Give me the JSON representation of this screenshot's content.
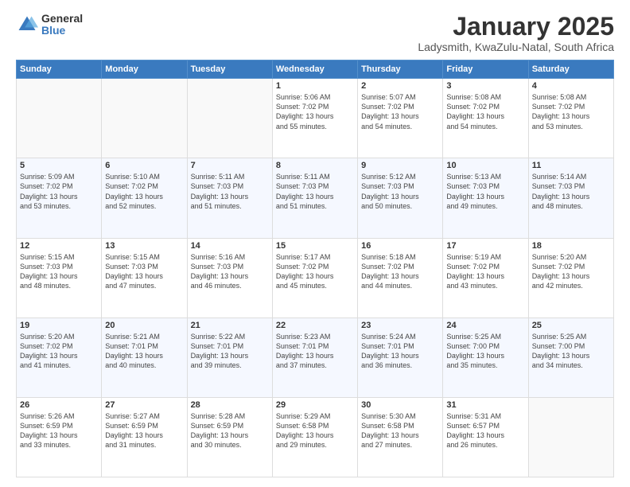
{
  "header": {
    "logo_general": "General",
    "logo_blue": "Blue",
    "month_title": "January 2025",
    "location": "Ladysmith, KwaZulu-Natal, South Africa"
  },
  "days_of_week": [
    "Sunday",
    "Monday",
    "Tuesday",
    "Wednesday",
    "Thursday",
    "Friday",
    "Saturday"
  ],
  "weeks": [
    [
      {
        "day": "",
        "info": ""
      },
      {
        "day": "",
        "info": ""
      },
      {
        "day": "",
        "info": ""
      },
      {
        "day": "1",
        "info": "Sunrise: 5:06 AM\nSunset: 7:02 PM\nDaylight: 13 hours\nand 55 minutes."
      },
      {
        "day": "2",
        "info": "Sunrise: 5:07 AM\nSunset: 7:02 PM\nDaylight: 13 hours\nand 54 minutes."
      },
      {
        "day": "3",
        "info": "Sunrise: 5:08 AM\nSunset: 7:02 PM\nDaylight: 13 hours\nand 54 minutes."
      },
      {
        "day": "4",
        "info": "Sunrise: 5:08 AM\nSunset: 7:02 PM\nDaylight: 13 hours\nand 53 minutes."
      }
    ],
    [
      {
        "day": "5",
        "info": "Sunrise: 5:09 AM\nSunset: 7:02 PM\nDaylight: 13 hours\nand 53 minutes."
      },
      {
        "day": "6",
        "info": "Sunrise: 5:10 AM\nSunset: 7:02 PM\nDaylight: 13 hours\nand 52 minutes."
      },
      {
        "day": "7",
        "info": "Sunrise: 5:11 AM\nSunset: 7:03 PM\nDaylight: 13 hours\nand 51 minutes."
      },
      {
        "day": "8",
        "info": "Sunrise: 5:11 AM\nSunset: 7:03 PM\nDaylight: 13 hours\nand 51 minutes."
      },
      {
        "day": "9",
        "info": "Sunrise: 5:12 AM\nSunset: 7:03 PM\nDaylight: 13 hours\nand 50 minutes."
      },
      {
        "day": "10",
        "info": "Sunrise: 5:13 AM\nSunset: 7:03 PM\nDaylight: 13 hours\nand 49 minutes."
      },
      {
        "day": "11",
        "info": "Sunrise: 5:14 AM\nSunset: 7:03 PM\nDaylight: 13 hours\nand 48 minutes."
      }
    ],
    [
      {
        "day": "12",
        "info": "Sunrise: 5:15 AM\nSunset: 7:03 PM\nDaylight: 13 hours\nand 48 minutes."
      },
      {
        "day": "13",
        "info": "Sunrise: 5:15 AM\nSunset: 7:03 PM\nDaylight: 13 hours\nand 47 minutes."
      },
      {
        "day": "14",
        "info": "Sunrise: 5:16 AM\nSunset: 7:03 PM\nDaylight: 13 hours\nand 46 minutes."
      },
      {
        "day": "15",
        "info": "Sunrise: 5:17 AM\nSunset: 7:02 PM\nDaylight: 13 hours\nand 45 minutes."
      },
      {
        "day": "16",
        "info": "Sunrise: 5:18 AM\nSunset: 7:02 PM\nDaylight: 13 hours\nand 44 minutes."
      },
      {
        "day": "17",
        "info": "Sunrise: 5:19 AM\nSunset: 7:02 PM\nDaylight: 13 hours\nand 43 minutes."
      },
      {
        "day": "18",
        "info": "Sunrise: 5:20 AM\nSunset: 7:02 PM\nDaylight: 13 hours\nand 42 minutes."
      }
    ],
    [
      {
        "day": "19",
        "info": "Sunrise: 5:20 AM\nSunset: 7:02 PM\nDaylight: 13 hours\nand 41 minutes."
      },
      {
        "day": "20",
        "info": "Sunrise: 5:21 AM\nSunset: 7:01 PM\nDaylight: 13 hours\nand 40 minutes."
      },
      {
        "day": "21",
        "info": "Sunrise: 5:22 AM\nSunset: 7:01 PM\nDaylight: 13 hours\nand 39 minutes."
      },
      {
        "day": "22",
        "info": "Sunrise: 5:23 AM\nSunset: 7:01 PM\nDaylight: 13 hours\nand 37 minutes."
      },
      {
        "day": "23",
        "info": "Sunrise: 5:24 AM\nSunset: 7:01 PM\nDaylight: 13 hours\nand 36 minutes."
      },
      {
        "day": "24",
        "info": "Sunrise: 5:25 AM\nSunset: 7:00 PM\nDaylight: 13 hours\nand 35 minutes."
      },
      {
        "day": "25",
        "info": "Sunrise: 5:25 AM\nSunset: 7:00 PM\nDaylight: 13 hours\nand 34 minutes."
      }
    ],
    [
      {
        "day": "26",
        "info": "Sunrise: 5:26 AM\nSunset: 6:59 PM\nDaylight: 13 hours\nand 33 minutes."
      },
      {
        "day": "27",
        "info": "Sunrise: 5:27 AM\nSunset: 6:59 PM\nDaylight: 13 hours\nand 31 minutes."
      },
      {
        "day": "28",
        "info": "Sunrise: 5:28 AM\nSunset: 6:59 PM\nDaylight: 13 hours\nand 30 minutes."
      },
      {
        "day": "29",
        "info": "Sunrise: 5:29 AM\nSunset: 6:58 PM\nDaylight: 13 hours\nand 29 minutes."
      },
      {
        "day": "30",
        "info": "Sunrise: 5:30 AM\nSunset: 6:58 PM\nDaylight: 13 hours\nand 27 minutes."
      },
      {
        "day": "31",
        "info": "Sunrise: 5:31 AM\nSunset: 6:57 PM\nDaylight: 13 hours\nand 26 minutes."
      },
      {
        "day": "",
        "info": ""
      }
    ]
  ]
}
